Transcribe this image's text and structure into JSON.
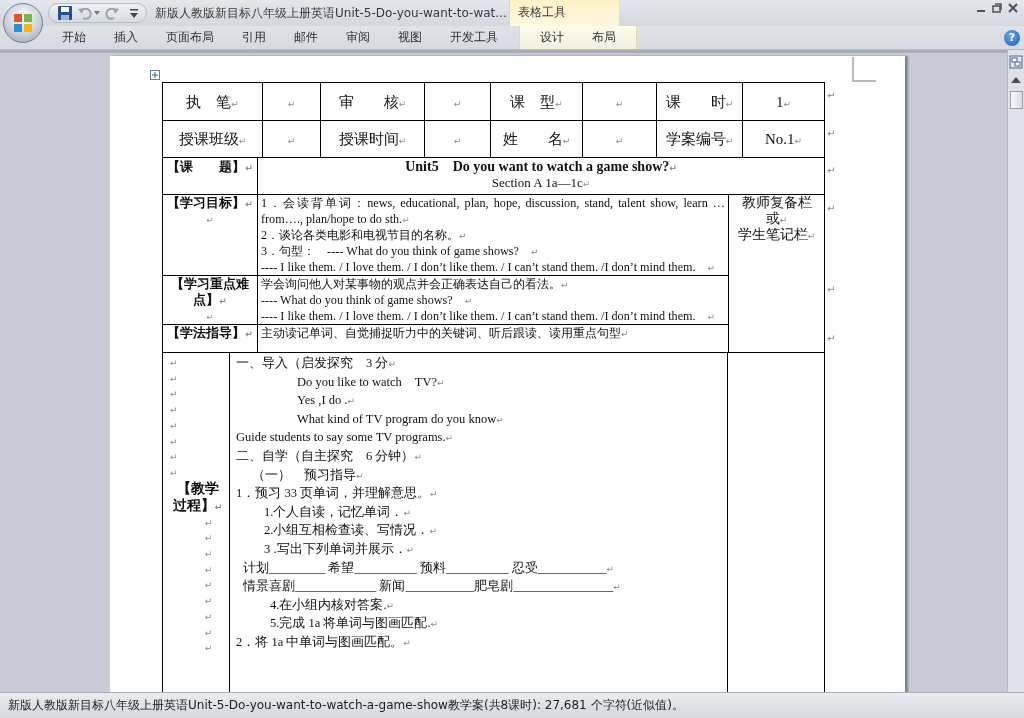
{
  "window": {
    "title": "新版人教版新目标八年级上册英语Unit-5-Do-you-want-to-wat...",
    "contextual_group": "表格工具",
    "help": "?"
  },
  "ribbon_tabs": [
    {
      "label": "开始",
      "kind": "main",
      "selected": false
    },
    {
      "label": "插入",
      "kind": "main",
      "selected": false
    },
    {
      "label": "页面布局",
      "kind": "main",
      "selected": false
    },
    {
      "label": "引用",
      "kind": "main",
      "selected": false
    },
    {
      "label": "邮件",
      "kind": "main",
      "selected": false
    },
    {
      "label": "审阅",
      "kind": "main",
      "selected": false
    },
    {
      "label": "视图",
      "kind": "main",
      "selected": false
    },
    {
      "label": "开发工具",
      "kind": "main",
      "selected": false
    },
    {
      "label": "设计",
      "kind": "contextual",
      "selected": false
    },
    {
      "label": "布局",
      "kind": "contextual",
      "selected": false
    }
  ],
  "document": {
    "rows": [
      {
        "kind": "info",
        "end_mark": "↵",
        "cells": [
          "执　笔↵",
          "↵",
          "审　　核↵",
          "↵",
          "课　型↵",
          "↵",
          "课　　时↵",
          "1↵"
        ]
      },
      {
        "kind": "info",
        "end_mark": "↵",
        "cells": [
          "授课班级↵",
          "↵",
          "授课时间↵",
          "↵",
          "姓　　名↵",
          "↵",
          "学案编号↵",
          "No.1↵"
        ]
      },
      {
        "kind": "topic",
        "end_mark": "↵",
        "label": [
          "【课　　题】↵"
        ],
        "content": [
          {
            "kind": "title",
            "text": "Unit5　Do you want to watch a game show?↵"
          },
          {
            "kind": "center",
            "text": "Section A 1a—1c↵"
          }
        ]
      },
      {
        "kind": "objectives",
        "sections": [
          {
            "end_mark": "↵",
            "label": [
              "【学习目标】↵",
              "↵"
            ],
            "content": [
              "1．会读背单词：news, educational, plan, hope, discussion, stand, talent show, learn …from…., plan/hope to do sth.↵",
              "2．谈论各类电影和电视节目的名称。↵",
              "3．句型：　---- What do you think of game shows?　↵",
              "---- I like them. / I love them. / I don’t like them. / I can’t stand them. /I don’t mind them.　↵"
            ]
          },
          {
            "end_mark": "↵",
            "label": [
              "【学习重点难点】↵",
              "↵"
            ],
            "content": [
              "学会询问他人对某事物的观点并会正确表达自己的看法。↵",
              "---- What do you think of game shows?　↵",
              "---- I like them. / I love them. / I don’t like them. / I can’t stand them. /I don’t mind them.　↵"
            ]
          },
          {
            "end_mark": "↵",
            "label": [
              "【学法指导】↵"
            ],
            "content": [
              "主动读记单词、自觉捕捉听力中的关键词、听后跟读、读用重点句型↵"
            ]
          }
        ],
        "notes": [
          "教师复备栏",
          "或↵",
          "学生笔记栏↵"
        ]
      },
      {
        "kind": "process",
        "label": [
          {
            "kind": "left",
            "text": "↵"
          },
          {
            "kind": "left",
            "text": "↵"
          },
          {
            "kind": "left",
            "text": "↵"
          },
          {
            "kind": "left",
            "text": "↵"
          },
          {
            "kind": "left",
            "text": "↵"
          },
          {
            "kind": "left",
            "text": "↵"
          },
          {
            "kind": "left",
            "text": "↵"
          },
          {
            "kind": "left",
            "text": "↵"
          },
          {
            "kind": "heading",
            "text": "【教学过程】↵"
          },
          {
            "kind": "center",
            "text": "↵"
          },
          {
            "kind": "center",
            "text": "↵"
          },
          {
            "kind": "center",
            "text": "↵"
          },
          {
            "kind": "center",
            "text": "↵"
          },
          {
            "kind": "center",
            "text": "↵"
          },
          {
            "kind": "center",
            "text": "↵"
          },
          {
            "kind": "center",
            "text": "↵"
          },
          {
            "kind": "center",
            "text": "↵"
          },
          {
            "kind": "center",
            "text": "↵"
          }
        ],
        "content": [
          {
            "kind": "plain",
            "text": "一、导入（启发探究　3 分↵"
          },
          {
            "kind": "deep",
            "text": "Do you like to watch　TV?↵"
          },
          {
            "kind": "deep",
            "text": "Yes ,I do .↵"
          },
          {
            "kind": "deep",
            "text": "What kind of TV program do you know↵"
          },
          {
            "kind": "plain",
            "text": "Guide students to say some TV programs.↵"
          },
          {
            "kind": "plain",
            "text": "二、自学（自主探究　6 分钟）↵"
          },
          {
            "kind": "half",
            "text": "（一）　预习指导↵"
          },
          {
            "kind": "plain",
            "text": "1．预习 33 页单词，并理解意思。↵"
          },
          {
            "kind": "sub",
            "text": "1.个人自读，记忆单词．↵"
          },
          {
            "kind": "sub",
            "text": "2.小组互相检查读、写情况．↵"
          },
          {
            "kind": "sub",
            "text": "3 .写出下列单词并展示．↵"
          },
          {
            "kind": "blanks",
            "text": "计划_________ 希望__________ 预料__________ 忍受___________↵"
          },
          {
            "kind": "blanks",
            "text": "情景喜剧_____________ 新闻___________肥皂剧________________↵"
          },
          {
            "kind": "sub2",
            "text": "4.在小组内核对答案.↵"
          },
          {
            "kind": "sub2",
            "text": "5.完成 1a 将单词与图画匹配.↵"
          },
          {
            "kind": "plain",
            "text": "2．将 1a 中单词与图画匹配。↵"
          }
        ]
      }
    ]
  },
  "status_bar": {
    "text": "新版人教版新目标八年级上册英语Unit-5-Do-you-want-to-watch-a-game-show教学案(共8课时): 27,681 个字符(近似值)。"
  }
}
